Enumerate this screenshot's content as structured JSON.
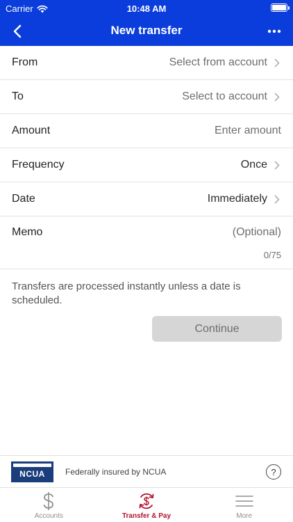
{
  "status_bar": {
    "carrier": "Carrier",
    "time": "10:48 AM"
  },
  "navbar": {
    "title": "New transfer"
  },
  "form": {
    "from": {
      "label": "From",
      "value": "Select from account"
    },
    "to": {
      "label": "To",
      "value": "Select to account"
    },
    "amount": {
      "label": "Amount",
      "placeholder": "Enter amount"
    },
    "frequency": {
      "label": "Frequency",
      "value": "Once"
    },
    "date": {
      "label": "Date",
      "value": "Immediately"
    },
    "memo": {
      "label": "Memo",
      "placeholder": "(Optional)",
      "counter": "0/75"
    }
  },
  "notice": "Transfers are processed instantly unless a date is scheduled.",
  "continue_label": "Continue",
  "footer": {
    "logo_text": "NCUA",
    "insured_text": "Federally insured by NCUA",
    "help_symbol": "?"
  },
  "tabs": [
    {
      "label": "Accounts",
      "icon": "dollar-icon"
    },
    {
      "label": "Transfer & Pay",
      "icon": "transfer-pay-icon",
      "active": true
    },
    {
      "label": "More",
      "icon": "hamburger-icon"
    }
  ],
  "colors": {
    "header": "#0a3ddb",
    "active_tab": "#b2122b",
    "button_disabled": "#d6d6d6"
  }
}
